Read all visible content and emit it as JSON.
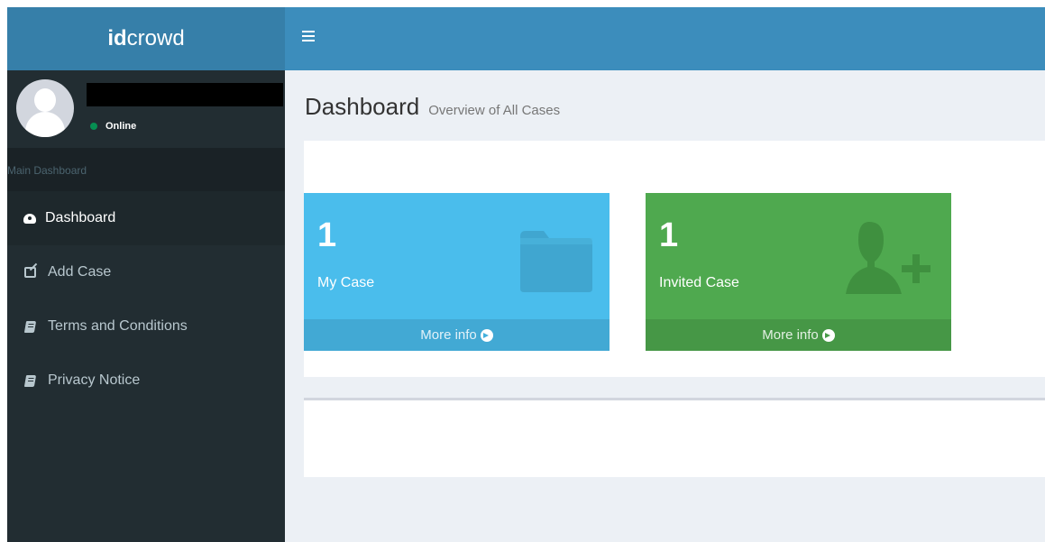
{
  "brand": {
    "bold": "id",
    "rest": "crowd"
  },
  "user": {
    "status": "Online"
  },
  "sidebar": {
    "header": "Main Dashboard",
    "items": [
      {
        "label": "Dashboard",
        "icon": "dashboard-icon",
        "active": true
      },
      {
        "label": "Add Case",
        "icon": "edit-icon"
      },
      {
        "label": "Terms and Conditions",
        "icon": "book-icon"
      },
      {
        "label": "Privacy Notice",
        "icon": "book-icon"
      }
    ]
  },
  "page": {
    "title": "Dashboard",
    "subtitle": "Overview of All Cases"
  },
  "cards": [
    {
      "count": "1",
      "label": "My Case",
      "more": "More info",
      "color": "#4abdec",
      "icon": "folder-icon"
    },
    {
      "count": "1",
      "label": "Invited Case",
      "more": "More info",
      "color": "#4fa94f",
      "icon": "user-plus-icon"
    }
  ],
  "colors": {
    "topbar": "#3c8dbc",
    "logo": "#367fa9",
    "sidebar": "#222d32"
  }
}
